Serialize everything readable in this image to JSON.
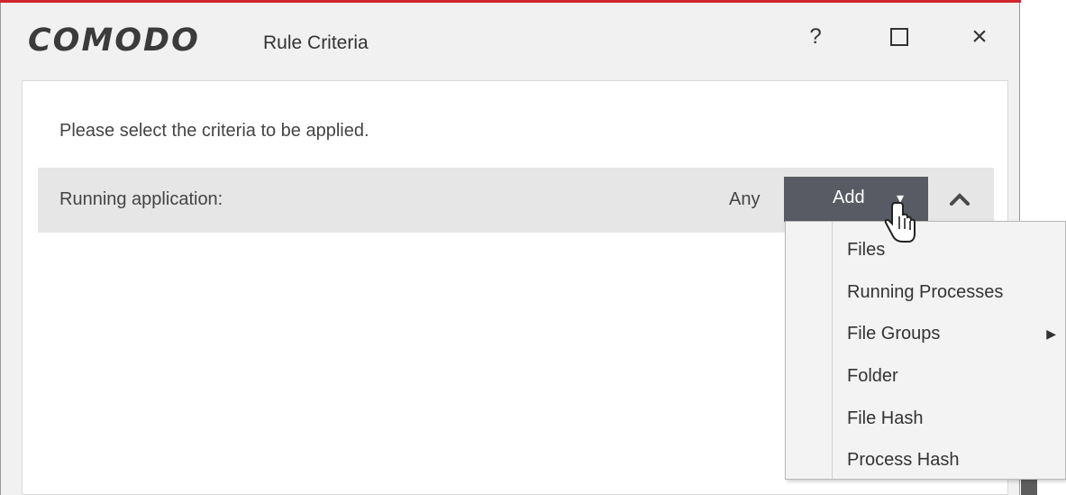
{
  "window": {
    "brand": "COMODO",
    "title": "Rule Criteria",
    "help_label": "?",
    "close_label": "×"
  },
  "main": {
    "prompt": "Please select the criteria to be applied.",
    "criteria": {
      "label": "Running application:",
      "value": "Any",
      "add_label": "Add",
      "add_caret": "▾"
    }
  },
  "menu": {
    "items": [
      {
        "label": "Files"
      },
      {
        "label": "Running Processes"
      },
      {
        "label": "File Groups",
        "arrow": "▶"
      },
      {
        "label": "Folder"
      },
      {
        "label": "File Hash"
      },
      {
        "label": "Process Hash"
      }
    ]
  },
  "colors": {
    "accent_strip": "#d2242c",
    "add_button": "#585b63",
    "panel_background": "#ffffff"
  }
}
